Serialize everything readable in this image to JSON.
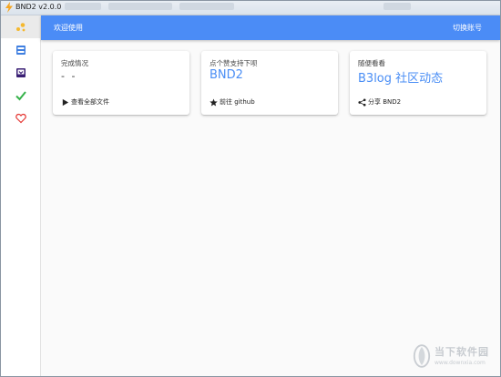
{
  "window": {
    "title": "BND2 v2.0.0",
    "icon": "bolt-icon"
  },
  "sidebar": {
    "items": [
      {
        "name": "blog-icon",
        "color": "#f5b82e",
        "active": true
      },
      {
        "name": "inbox-icon",
        "color": "#3f7fe0"
      },
      {
        "name": "download-icon",
        "color": "#3a1f74"
      },
      {
        "name": "check-icon",
        "color": "#36b24a"
      },
      {
        "name": "heart-icon",
        "color": "#e53935"
      }
    ]
  },
  "header": {
    "welcome": "欢迎使用",
    "switch_account": "切换账号",
    "color": "#4b8cf6"
  },
  "cards": [
    {
      "subtitle": "完成情况",
      "value": "- -",
      "action_label": "查看全部文件",
      "action_icon": "play-icon"
    },
    {
      "subtitle": "点个赞支持下呗",
      "value": "BND2",
      "action_label": "前往 github",
      "action_icon": "star-icon"
    },
    {
      "subtitle": "随便看看",
      "value": "B3log 社区动态",
      "action_label": "分享 BND2",
      "action_icon": "share-icon"
    }
  ],
  "watermark": {
    "title": "当下软件园",
    "url": "www.downxia.com"
  }
}
